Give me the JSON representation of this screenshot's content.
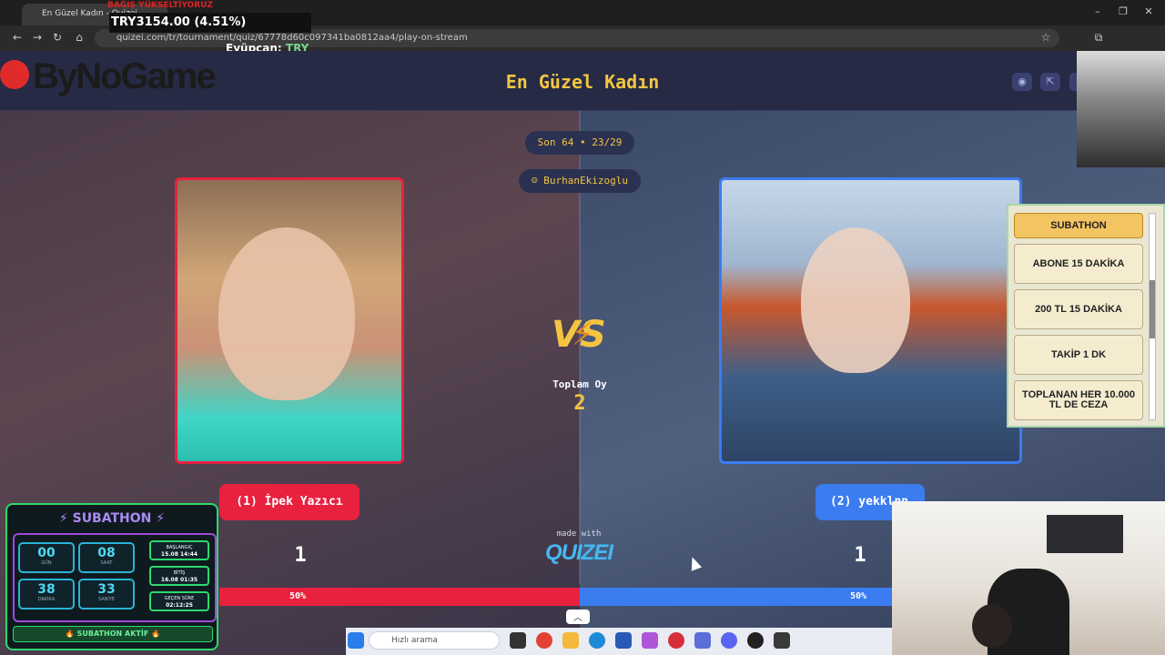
{
  "browser": {
    "tab_title": "En Güzel Kadın - Quizei",
    "url": "quizei.com/tr/tournament/quiz/67778d60c097341ba0812aa4/play-on-stream"
  },
  "overlay": {
    "ticker_red": "BAĞIŞ YÜKSELTİYORUZ",
    "ticker": "TRY3154.00 (4.51%)",
    "donor_name": "Eyüpcan:",
    "donor_currency": "TRY"
  },
  "header": {
    "logo": "ByNoGame",
    "title": "En Güzel Kadın",
    "icons": [
      "eye-icon",
      "share-icon",
      "send-icon",
      "flag-icon"
    ]
  },
  "match": {
    "round": "Son 64 • 23/29",
    "creator": "BurhanEkizoglu",
    "vs": "VS",
    "total_label": "Toplam Oy",
    "total_value": "2",
    "left": {
      "name": "(1) İpek Yazıcı",
      "votes": "1",
      "percent": "50%"
    },
    "right": {
      "name": "(2) yekklnn",
      "votes": "1",
      "percent": "50%"
    },
    "made_with": "made with",
    "brand": "QUIZEI",
    "progress_left_fraction": 0.5
  },
  "side_panel": {
    "buttons": [
      "SUBATHON",
      "ABONE 15 DAKİKA",
      "200 TL 15 DAKİKA",
      "TAKİP 1 DK",
      "TOPLANAN HER 10.000 TL DE CEZA"
    ],
    "active": "SUBATHON"
  },
  "subathon": {
    "title": "⚡ SUBATHON ⚡",
    "timer": [
      {
        "value": "00",
        "label": "GÜN"
      },
      {
        "value": "08",
        "label": "SAAT"
      },
      {
        "value": "38",
        "label": "DAKİKA"
      },
      {
        "value": "33",
        "label": "SANİYE"
      }
    ],
    "info": [
      {
        "label": "BAŞLANGIÇ",
        "value": "15.08 14:44"
      },
      {
        "label": "BİTİŞ",
        "value": "16.08 01:35"
      },
      {
        "label": "GEÇEN SÜRE",
        "value": "02:12:25"
      }
    ],
    "footer": "🔥 SUBATHON AKTİF 🔥"
  },
  "taskbar": {
    "search_placeholder": "Hızlı arama"
  },
  "colors": {
    "left_accent": "#e8213f",
    "right_accent": "#3b7cf0",
    "title_yellow": "#f4c542"
  }
}
